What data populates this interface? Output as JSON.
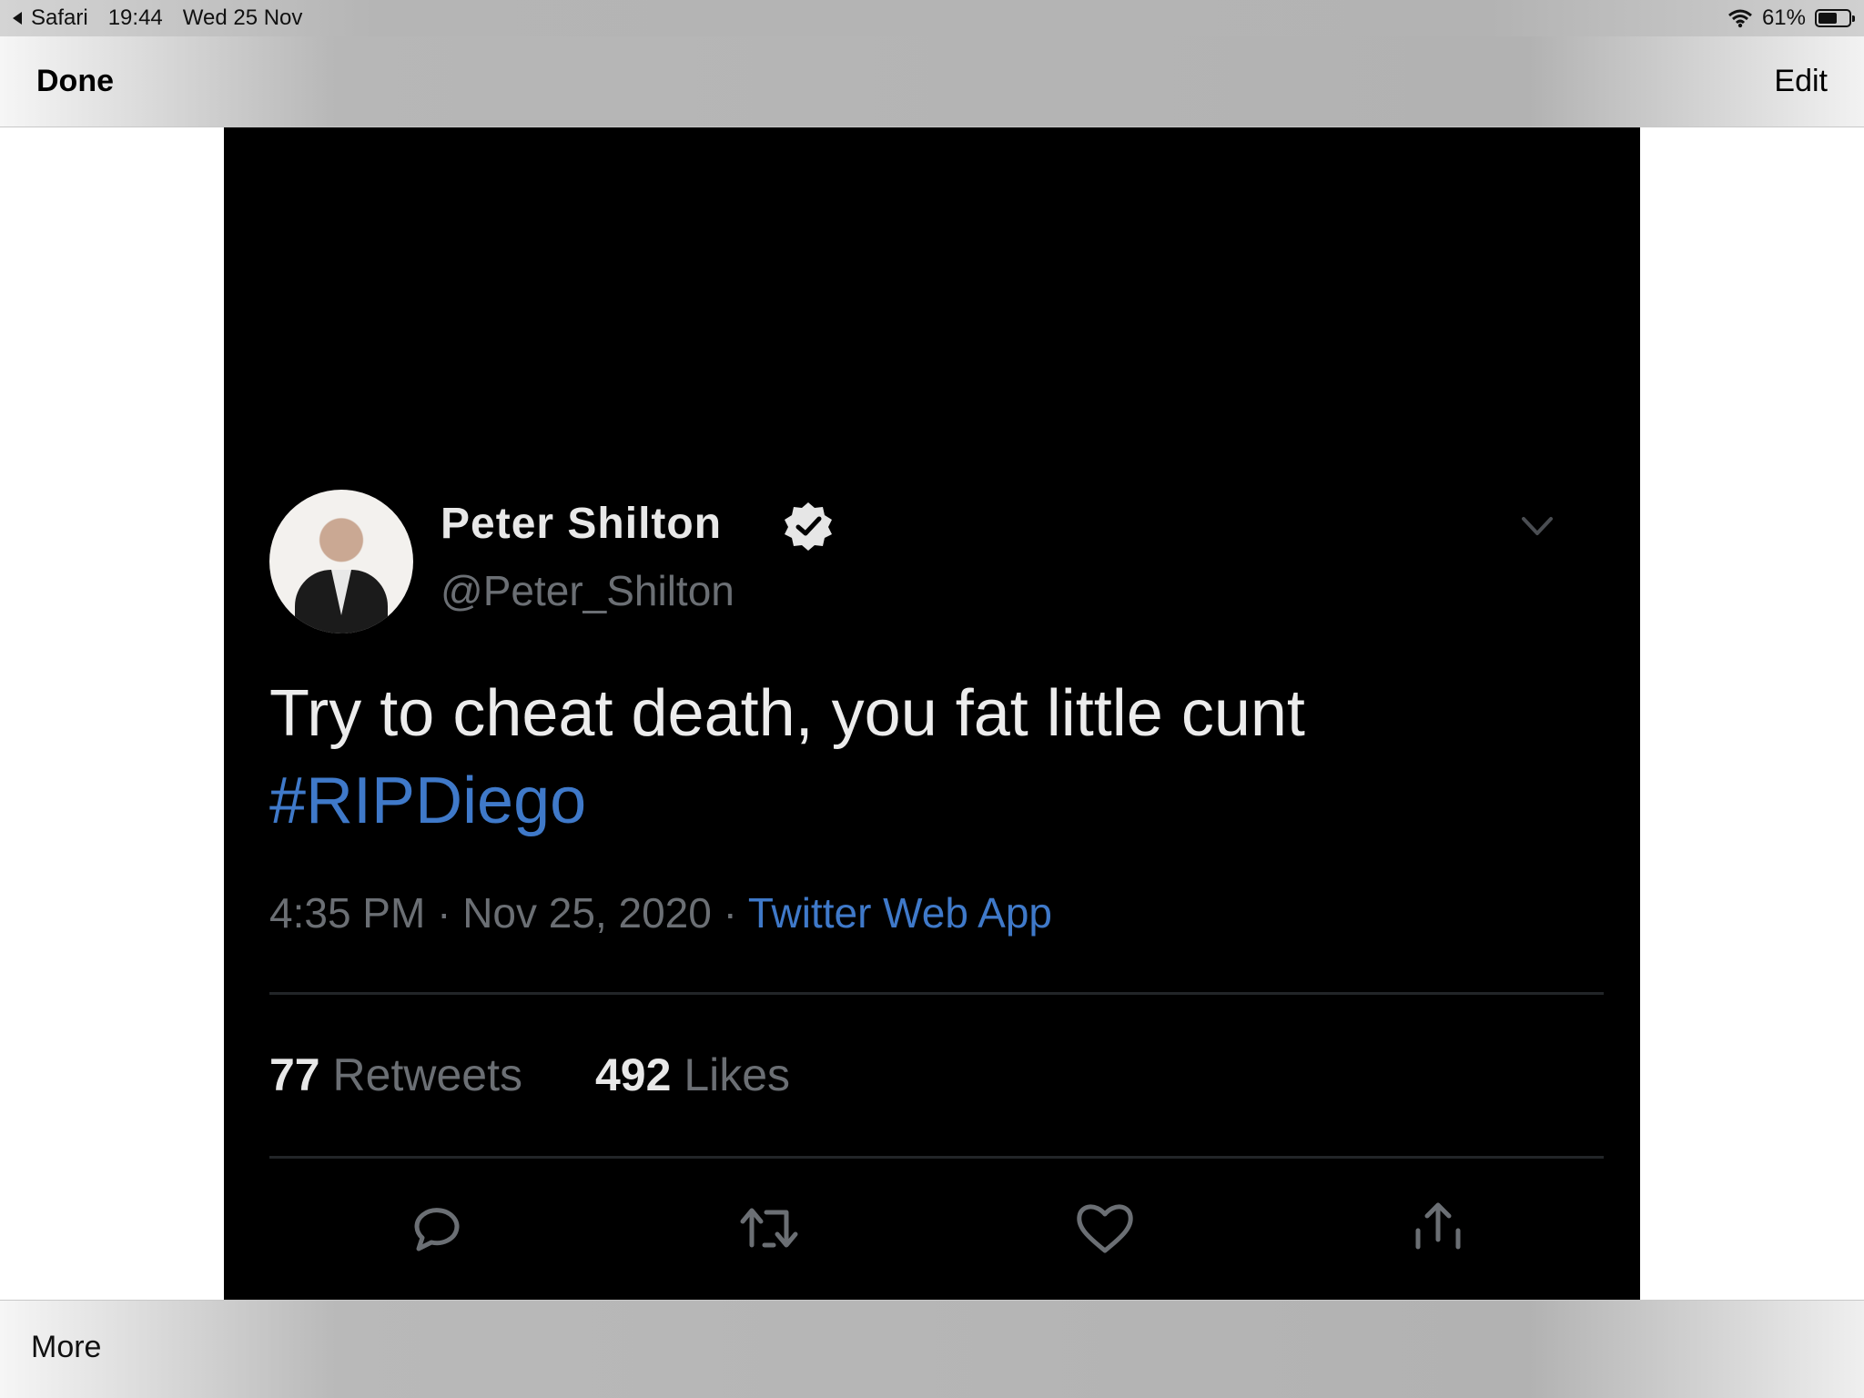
{
  "status_bar": {
    "app": "Safari",
    "time": "19:44",
    "date": "Wed 25 Nov",
    "battery": "61%",
    "battery_level": 0.61,
    "icons": [
      "back-arrow-icon",
      "wifi-icon",
      "battery-icon"
    ]
  },
  "nav": {
    "done_label": "Done",
    "edit_label": "Edit"
  },
  "tweet": {
    "display_name": "Peter Shilton",
    "handle": "@Peter_Shilton",
    "text_main": "Try to cheat death, you fat little cunt",
    "hashtag": "#RIPDiego",
    "time": "4:35 PM",
    "separator": "·",
    "date": "Nov 25, 2020",
    "source": "Twitter Web App",
    "retweets_count": "77",
    "retweets_label": "Retweets",
    "likes_count": "492",
    "likes_label": "Likes",
    "colors": {
      "link": "#3f79c9",
      "muted": "#6b6f74",
      "background": "#000000"
    },
    "actions": [
      "reply-icon",
      "retweet-icon",
      "like-icon",
      "share-icon"
    ]
  },
  "bottom": {
    "more_label": "More"
  }
}
